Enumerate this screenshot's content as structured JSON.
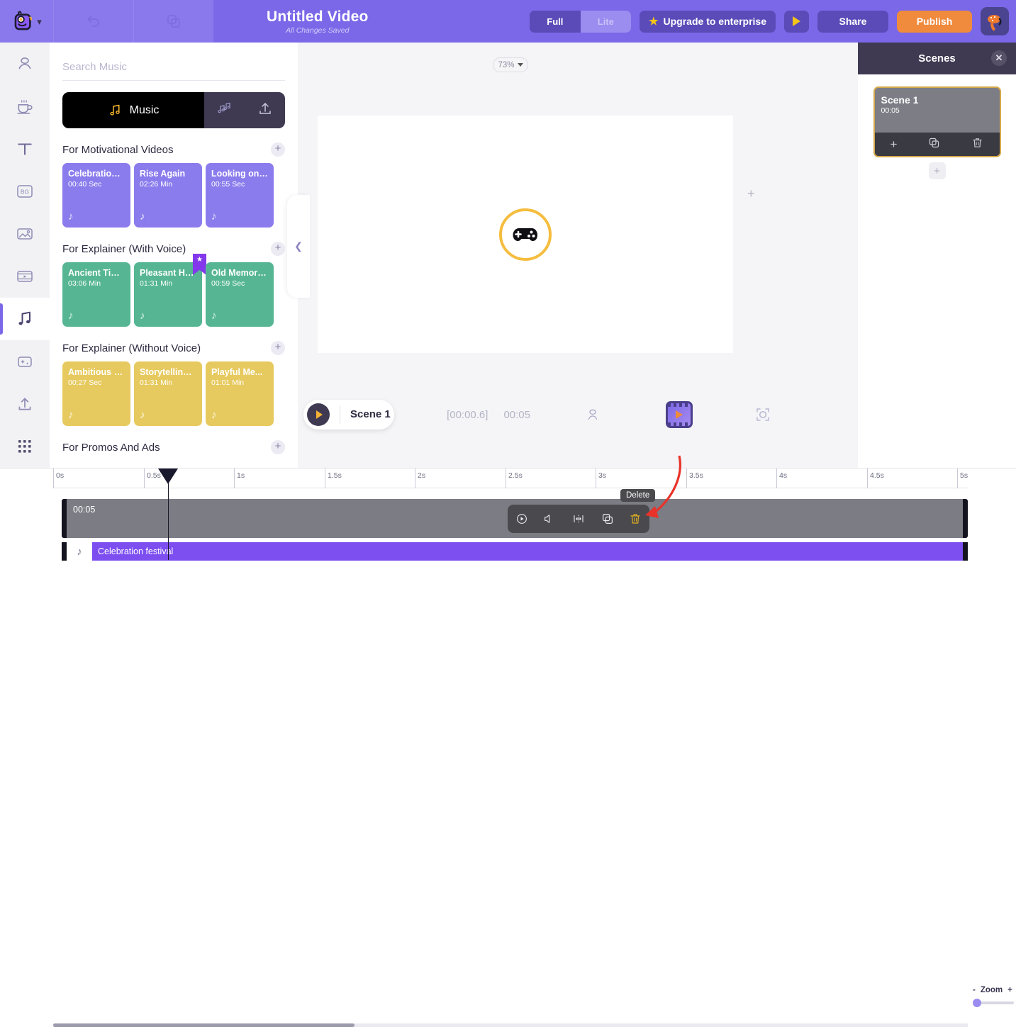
{
  "topbar": {
    "logo_icon": "mascot-logo-icon",
    "chevron_icon": "chevron-down-icon",
    "undo_icon": "undo-icon",
    "copy_icon": "duplicate-icon",
    "title": "Untitled Video",
    "subtitle": "All Changes Saved",
    "segment": {
      "full": "Full",
      "lite": "Lite",
      "selected": "Full"
    },
    "upgrade_label": "Upgrade to enterprise",
    "star_icon": "star-icon",
    "preview_icon": "play-icon",
    "share_label": "Share",
    "publish_label": "Publish",
    "avatar_icon": "user-avatar-icon",
    "colors": {
      "bar": "#7b68e8",
      "publish": "#f08a3c",
      "button": "#5b4bb8",
      "star": "#f5c518"
    }
  },
  "rail": {
    "items": [
      {
        "name": "avatar",
        "icon": "person-icon"
      },
      {
        "name": "scene",
        "icon": "coffee-cup-icon"
      },
      {
        "name": "text",
        "icon": "text-t-icon"
      },
      {
        "name": "background",
        "icon": "bg-box-icon",
        "label": "BG"
      },
      {
        "name": "image",
        "icon": "image-icon"
      },
      {
        "name": "video",
        "icon": "film-strip-icon"
      },
      {
        "name": "music",
        "icon": "music-note-icon",
        "active": true
      },
      {
        "name": "effects",
        "icon": "sparkle-box-icon"
      },
      {
        "name": "upload",
        "icon": "upload-icon"
      },
      {
        "name": "apps",
        "icon": "grid-apps-icon"
      }
    ],
    "bottom": [
      {
        "name": "video-record",
        "icon": "film-play-badge-icon"
      },
      {
        "name": "voice-record",
        "icon": "microphone-add-icon"
      }
    ]
  },
  "music_panel": {
    "search_placeholder": "Search Music",
    "search_value": "",
    "tabs": [
      {
        "label": "Music",
        "icon": "music-note-icon",
        "active": true
      },
      {
        "label": "",
        "icon": "sound-effects-icon",
        "active": false
      },
      {
        "label": "",
        "icon": "upload-icon",
        "active": false
      }
    ],
    "categories": [
      {
        "title": "For Motivational Videos",
        "color": "#8b7ced",
        "tracks": [
          {
            "name": "Celebration ...",
            "duration": "00:40 Sec",
            "featured": false
          },
          {
            "name": "Rise Again",
            "duration": "02:26 Min",
            "featured": false
          },
          {
            "name": "Looking on ...",
            "duration": "00:55 Sec",
            "featured": false
          }
        ]
      },
      {
        "title": "For Explainer (With Voice)",
        "color": "#56b694",
        "tracks": [
          {
            "name": "Ancient Times",
            "duration": "03:06 Min",
            "featured": false
          },
          {
            "name": "Pleasant Ha...",
            "duration": "01:31 Min",
            "featured": true
          },
          {
            "name": "Old Memories",
            "duration": "00:59 Sec",
            "featured": false
          }
        ]
      },
      {
        "title": "For Explainer (Without Voice)",
        "color": "#e7ca5f",
        "tracks": [
          {
            "name": "Ambitious D...",
            "duration": "00:27 Sec",
            "featured": false
          },
          {
            "name": "Storytelling ...",
            "duration": "01:31 Min",
            "featured": false
          },
          {
            "name": "Playful Me...",
            "duration": "01:01 Min",
            "featured": false
          }
        ]
      },
      {
        "title": "For Promos And Ads",
        "color": "#8b7ced",
        "tracks": []
      }
    ],
    "add_icon": "plus-icon"
  },
  "stage": {
    "zoom_level": "73%",
    "zoom_caret_icon": "caret-down-icon",
    "canvas_icon": "gamepad-icon",
    "canvas_circle_color": "#f5bd3f",
    "add_scene_side_icon": "plus-icon",
    "collapse_icon": "chevron-left-icon"
  },
  "scenebar": {
    "play_icon": "play-icon",
    "scene_label": "Scene 1",
    "time_current": "[00:00.6]",
    "time_total": "00:05",
    "avatar_icon": "person-outline-icon",
    "video_icon": "film-play-badge-icon",
    "crop_icon": "crop-frame-icon"
  },
  "scenes_panel": {
    "title": "Scenes",
    "close_icon": "close-icon",
    "scenes": [
      {
        "name": "Scene 1",
        "duration": "00:05",
        "selected": true,
        "actions": [
          {
            "name": "add",
            "icon": "plus-icon"
          },
          {
            "name": "duplicate",
            "icon": "duplicate-icon"
          },
          {
            "name": "delete",
            "icon": "trash-icon"
          }
        ]
      }
    ],
    "add_scene_icon": "plus-icon"
  },
  "timeline": {
    "ruler_ticks": [
      "0s",
      "0.5s",
      "1s",
      "1.5s",
      "2s",
      "2.5s",
      "3s",
      "3.5s",
      "4s",
      "4.5s",
      "5s"
    ],
    "playhead_position": "0.55s",
    "scene_track": {
      "label": "00:05",
      "color": "#7c7c84"
    },
    "audio_track": {
      "label": "Celebration festival",
      "color": "#7d4ef0",
      "icon": "music-note-icon"
    },
    "clip_toolbar": [
      {
        "name": "play",
        "icon": "play-circle-icon"
      },
      {
        "name": "volume",
        "icon": "speaker-icon"
      },
      {
        "name": "split",
        "icon": "split-icon"
      },
      {
        "name": "duplicate",
        "icon": "duplicate-icon"
      },
      {
        "name": "delete",
        "icon": "trash-icon",
        "highlighted": true
      }
    ],
    "tooltip": "Delete",
    "zoom": {
      "minus": "-",
      "label": "Zoom",
      "plus": "+",
      "value": 3
    }
  }
}
